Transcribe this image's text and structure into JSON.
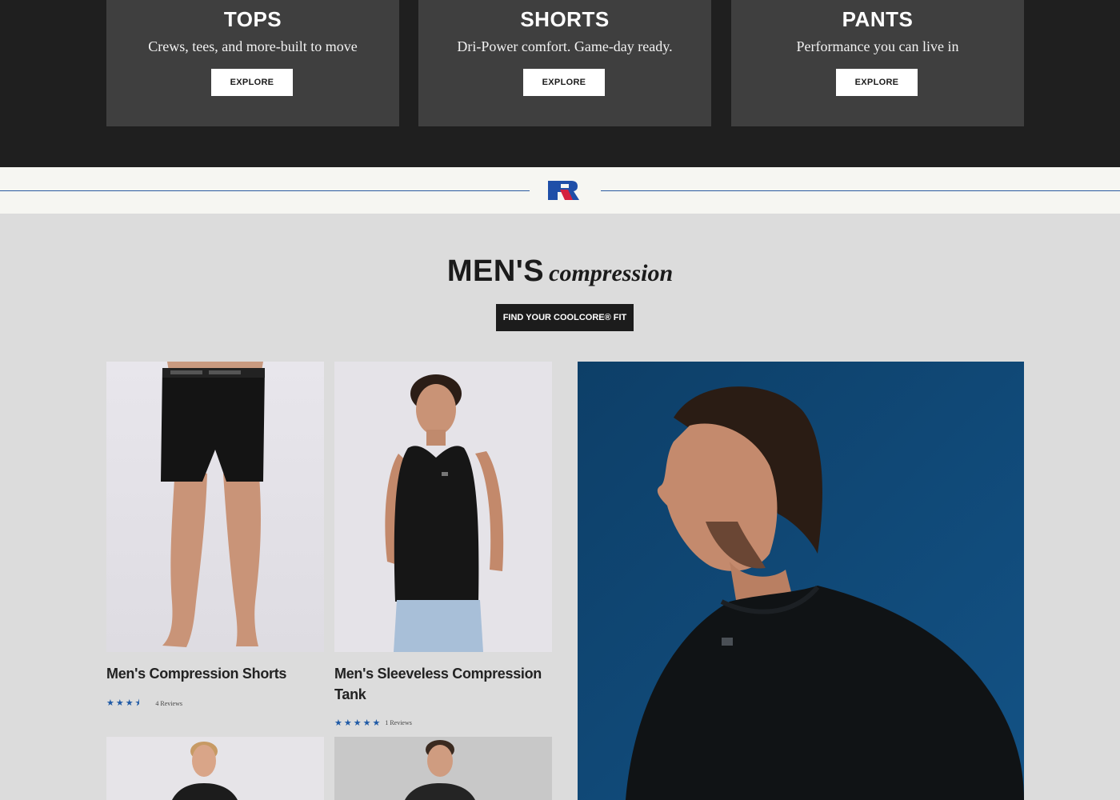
{
  "categories": [
    {
      "title": "TOPS",
      "subtitle": "Crews, tees, and more-built to move",
      "button": "EXPLORE"
    },
    {
      "title": "SHORTS",
      "subtitle": "Dri-Power comfort. Game-day ready.",
      "button": "EXPLORE"
    },
    {
      "title": "PANTS",
      "subtitle": "Performance you can live in",
      "button": "EXPLORE"
    }
  ],
  "section": {
    "title_bold": "MEN'S",
    "title_script": "compression",
    "cta": "FIND YOUR COOLCORE® FIT"
  },
  "products": [
    {
      "name": "Men's Compression Shorts",
      "stars": "★★★⯨",
      "rating": 3.5,
      "reviews": "4 Reviews"
    },
    {
      "name": "Men's Sleeveless Compression Tank",
      "stars": "★★★★★",
      "rating": 5,
      "reviews": "1 Reviews"
    }
  ],
  "colors": {
    "category_bg": "#1f1f1f",
    "card_bg": "#3f3f3f",
    "logo_blue": "#1f4fa8",
    "logo_red": "#d41f3d",
    "star_blue": "#1f5aa6",
    "page_bg": "#dcdcdc",
    "hero_sky": "#0f4571"
  }
}
